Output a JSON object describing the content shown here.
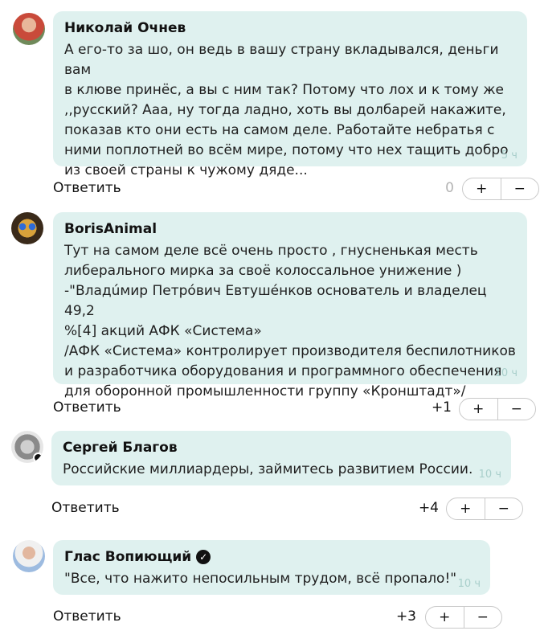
{
  "comments": [
    {
      "author": "Николай Очнев",
      "text": "А его-то за шо, он ведь в вашу страну вкладывался, деньги вам\nв клюве принёс, а вы с ним так? Потому что лох и к тому же\n,,русский? Ааа, ну тогда ладно, хоть вы долбарей накажите,\nпоказав кто они есть на самом деле. Работайте небратья с\nними поплотней во всём мире, потому что нех тащить добро\nиз своей страны к чужому дяде...",
      "time": "5 ч",
      "reply_label": "Ответить",
      "score": "0",
      "plus": "+",
      "minus": "−"
    },
    {
      "author": "BorisAnimal",
      "text": "Тут на самом деле всё очень просто , гнусненькая месть\nлиберального мирка за своё колоссальное унижение )\n-\"Владúмир Петрóвич Евтушéнков основатель и владелец 49,2\n%[4] акций АФК «Система»\n/АФК «Система» контролирует производителя беспилотников\nи разработчика оборудования и программного обеспечения\nдля оборонной промышленности группу «Кронштадт»/",
      "time": "10 ч",
      "reply_label": "Ответить",
      "score": "+1",
      "plus": "+",
      "minus": "−"
    },
    {
      "author": "Сергей Благов",
      "text": "Российские миллиардеры, займитесь развитием России.",
      "time": "10 ч",
      "reply_label": "Ответить",
      "score": "+4",
      "plus": "+",
      "minus": "−"
    },
    {
      "author": "Глас Вопиющий",
      "text": "\"Все, что нажито непосильным трудом, всё пропало!\"",
      "time": "10 ч",
      "reply_label": "Ответить",
      "score": "+3",
      "plus": "+",
      "minus": "−"
    }
  ],
  "colors": {
    "bubble": "#dff1ef",
    "time": "#a9cfcb",
    "score_zero": "#b3b3b3"
  }
}
